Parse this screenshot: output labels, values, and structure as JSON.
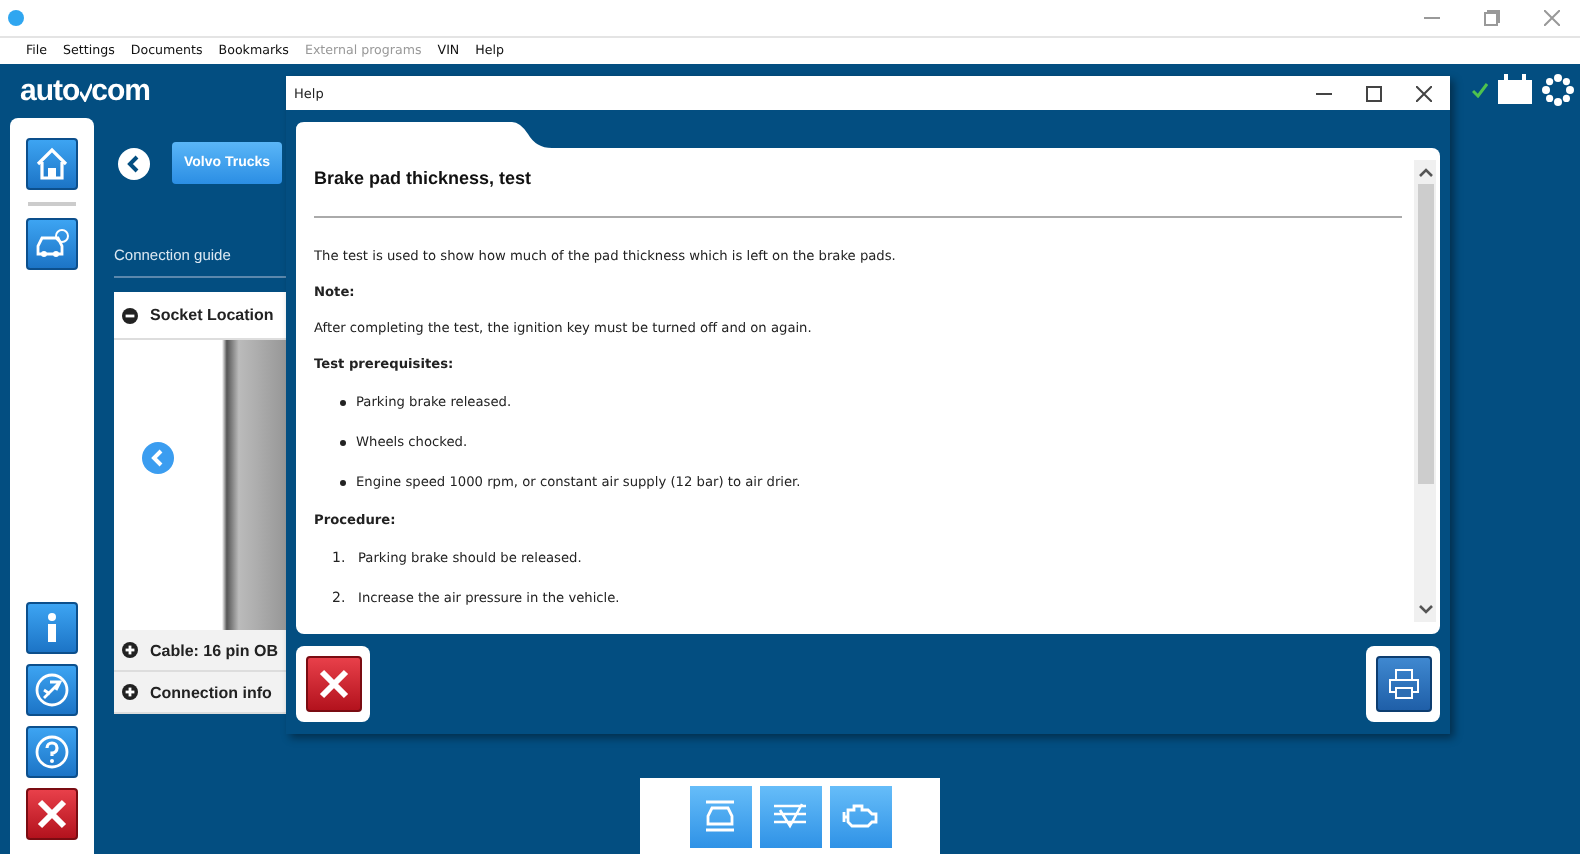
{
  "menu": [
    {
      "label": "File",
      "disabled": false
    },
    {
      "label": "Settings",
      "disabled": false
    },
    {
      "label": "Documents",
      "disabled": false
    },
    {
      "label": "Bookmarks",
      "disabled": false
    },
    {
      "label": "External programs",
      "disabled": true
    },
    {
      "label": "VIN",
      "disabled": false
    },
    {
      "label": "Help",
      "disabled": false
    }
  ],
  "logo": {
    "left": "auto",
    "right": "com"
  },
  "vehicle_button": "Volvo Trucks",
  "connection_guide": {
    "title": "Connection guide",
    "sections": [
      {
        "label": "Socket Location",
        "expanded": true
      },
      {
        "label": "Cable: 16 pin OB",
        "expanded": false
      },
      {
        "label": "Connection info",
        "expanded": false
      }
    ]
  },
  "help_dialog": {
    "title": "Help",
    "heading": "Brake pad thickness, test",
    "content": [
      {
        "kind": "paragraph",
        "text": "The test is used to show how much of the pad thickness which is left on the brake pads."
      },
      {
        "kind": "label",
        "text": "Note:"
      },
      {
        "kind": "paragraph",
        "text": "After completing the test, the ignition key must be turned off and on again."
      },
      {
        "kind": "label",
        "text": "Test prerequisites:"
      },
      {
        "kind": "bullet",
        "text": "Parking brake released."
      },
      {
        "kind": "bullet",
        "text": "Wheels chocked."
      },
      {
        "kind": "bullet",
        "text": "Engine speed 1000 rpm, or constant air supply (12 bar) to air drier."
      },
      {
        "kind": "label",
        "text": "Procedure:"
      },
      {
        "kind": "numbered",
        "number": "1.",
        "text": "Parking brake should be released."
      },
      {
        "kind": "numbered",
        "number": "2.",
        "text": "Increase the air pressure in the vehicle."
      }
    ]
  }
}
